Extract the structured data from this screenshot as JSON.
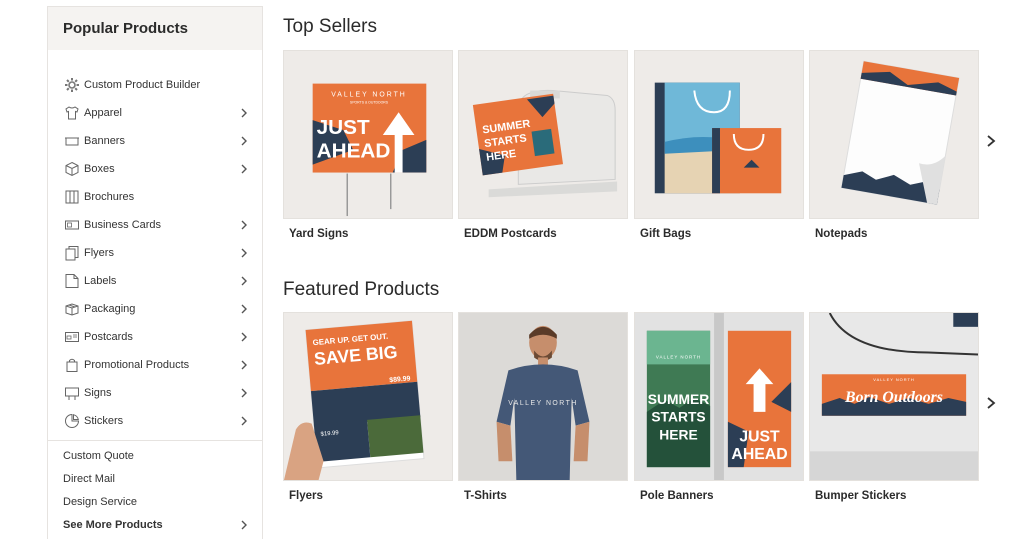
{
  "sidebar": {
    "title": "Popular Products",
    "items": [
      {
        "label": "Custom Product Builder",
        "icon": "gear-icon",
        "chevron": false
      },
      {
        "label": "Apparel",
        "icon": "tshirt-icon",
        "chevron": true
      },
      {
        "label": "Banners",
        "icon": "banner-icon",
        "chevron": true
      },
      {
        "label": "Boxes",
        "icon": "box-icon",
        "chevron": true
      },
      {
        "label": "Brochures",
        "icon": "brochure-icon",
        "chevron": false
      },
      {
        "label": "Business Cards",
        "icon": "business-card-icon",
        "chevron": true
      },
      {
        "label": "Flyers",
        "icon": "flyer-icon",
        "chevron": true
      },
      {
        "label": "Labels",
        "icon": "label-icon",
        "chevron": true
      },
      {
        "label": "Packaging",
        "icon": "package-icon",
        "chevron": true
      },
      {
        "label": "Postcards",
        "icon": "postcard-icon",
        "chevron": true
      },
      {
        "label": "Promotional Products",
        "icon": "bag-icon",
        "chevron": true
      },
      {
        "label": "Signs",
        "icon": "sign-icon",
        "chevron": true
      },
      {
        "label": "Stickers",
        "icon": "sticker-icon",
        "chevron": true
      }
    ],
    "extras": [
      {
        "label": "Custom Quote"
      },
      {
        "label": "Direct Mail"
      },
      {
        "label": "Design Service"
      },
      {
        "label": "See More Products"
      }
    ]
  },
  "top_sellers": {
    "title": "Top Sellers",
    "products": [
      {
        "label": "Yard Signs",
        "sign_brand": "VALLEY NORTH",
        "sign_sub": "SPORTS & OUTDOORS",
        "sign_text_1": "JUST",
        "sign_text_2": "AHEAD"
      },
      {
        "label": "EDDM Postcards",
        "card_text_1": "SUMMER",
        "card_text_2": "STARTS",
        "card_text_3": "HERE"
      },
      {
        "label": "Gift Bags"
      },
      {
        "label": "Notepads"
      }
    ]
  },
  "featured": {
    "title": "Featured Products",
    "products": [
      {
        "label": "Flyers",
        "flyer_text_1": "GEAR UP. GET OUT.",
        "flyer_text_2": "SAVE BIG",
        "flyer_price_1": "$89.99",
        "flyer_price_2": "$19.99"
      },
      {
        "label": "T-Shirts",
        "shirt_text": "VALLEY NORTH"
      },
      {
        "label": "Pole Banners",
        "banner_brand": "VALLEY NORTH",
        "banner_left_1": "SUMMER",
        "banner_left_2": "STARTS",
        "banner_left_3": "HERE",
        "banner_right_1": "JUST",
        "banner_right_2": "AHEAD"
      },
      {
        "label": "Bumper Stickers",
        "sticker_brand": "VALLEY NORTH",
        "sticker_text": "Born Outdoors"
      }
    ]
  },
  "colors": {
    "accent_orange": "#e8743b",
    "navy": "#2c3e55",
    "card_bg": "#efedeb"
  }
}
